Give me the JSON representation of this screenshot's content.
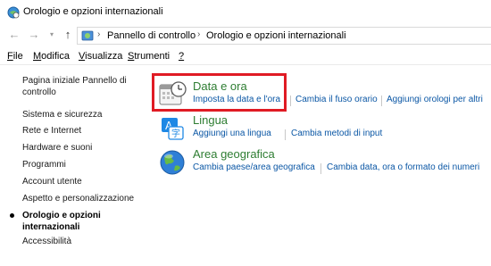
{
  "window": {
    "title": "Orologio e opzioni internazionali"
  },
  "address": {
    "crumbs": [
      "Pannello di controllo",
      "Orologio e opzioni internazionali"
    ]
  },
  "menu": {
    "items": [
      {
        "label": "File",
        "key": "F"
      },
      {
        "label": "Modifica",
        "key": "M"
      },
      {
        "label": "Visualizza",
        "key": "V"
      },
      {
        "label": "Strumenti",
        "key": "S"
      },
      {
        "label": "?",
        "key": "?"
      }
    ]
  },
  "sidebar": {
    "home_line1": "Pagina iniziale Pannello di",
    "home_line2": "controllo",
    "items": [
      "Sistema e sicurezza",
      "Rete e Internet",
      "Hardware e suoni",
      "Programmi",
      "Account utente",
      "Aspetto e personalizzazione"
    ],
    "current_line1": "Orologio e opzioni",
    "current_line2": "internazionali",
    "accessibility": "Accessibilità"
  },
  "categories": [
    {
      "title": "Data e ora",
      "icon": "clock-calendar-icon",
      "links": [
        "Imposta la data e l'ora",
        "Cambia il fuso orario",
        "Aggiungi orologi per altri"
      ]
    },
    {
      "title": "Lingua",
      "icon": "language-icon",
      "links": [
        "Aggiungi una lingua",
        "Cambia metodi di input"
      ]
    },
    {
      "title": "Area geografica",
      "icon": "globe-icon",
      "links": [
        "Cambia paese/area geografica",
        "Cambia data, ora o formato dei numeri"
      ]
    }
  ],
  "colors": {
    "category_title": "#2e7d32",
    "link": "#0b57a5",
    "highlight": "#e01b24"
  }
}
